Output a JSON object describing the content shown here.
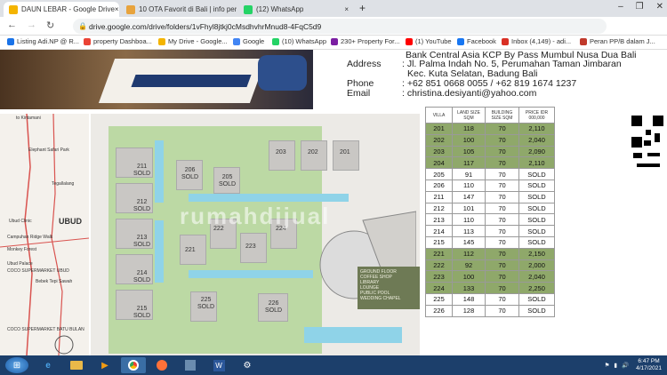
{
  "tabs": [
    {
      "title": "DAUN LEBAR - Google Drive",
      "color": "#f4b400",
      "active": true
    },
    {
      "title": "10 OTA Favorit di Bali | info perh",
      "color": "#e8a33d",
      "active": false
    },
    {
      "title": "(12) WhatsApp",
      "color": "#25d366",
      "active": false
    }
  ],
  "tab_close": "×",
  "new_tab": "+",
  "window_controls": [
    "–",
    "❐",
    "✕"
  ],
  "nav": {
    "back": "←",
    "forward": "→",
    "reload": "↻",
    "lock": "🔒"
  },
  "url": "drive.google.com/drive/folders/1vFhyl8jtkj0cMsdhvhrMnud8-4FqC5d9",
  "bookmarks": [
    {
      "label": "Listing Adi.NP @ R...",
      "color": "#1a73e8"
    },
    {
      "label": "property Dashboa...",
      "color": "#ea4335"
    },
    {
      "label": "My Drive - Google...",
      "color": "#f4b400"
    },
    {
      "label": "Google",
      "color": "#4285f4"
    },
    {
      "label": "(10) WhatsApp",
      "color": "#25d366"
    },
    {
      "label": "230+ Property For...",
      "color": "#7b1fa2"
    },
    {
      "label": "(1) YouTube",
      "color": "#ff0000"
    },
    {
      "label": "Facebook",
      "color": "#1877f2"
    },
    {
      "label": "Inbox (4,149) - adi...",
      "color": "#d93025"
    },
    {
      "label": "Peran PP/B dalam J...",
      "color": "#c0392b"
    }
  ],
  "contact": {
    "bank": "Bank Central Asia KCP By Pass Mumbul Nusa Dua Bali",
    "address_label": "Address",
    "address": [
      ": Jl. Palma Indah No. 5, Perumahan Taman Jimbaran",
      "Kec. Kuta Selatan, Badung Bali"
    ],
    "phone_label": "Phone",
    "phone": ": +62 851 0668 0055 / +62 819 1674 1237",
    "email_label": "Email",
    "email": ": christina.desiyanti@yahoo.com"
  },
  "map": {
    "title": "UBUD",
    "labels": [
      "to Kintamani",
      "Elephant Safari Park",
      "Ubud Clinic",
      "Campuhan Ridge Walk",
      "Monkey Forest",
      "Ubud Palace",
      "COCO SUPERMARKET UBUD",
      "Bebek Tepi Sawah",
      "COCO SUPERMARKET BATU BULAN",
      "Tegallalang"
    ]
  },
  "plan": {
    "villas": [
      {
        "num": "211",
        "status": "SOLD"
      },
      {
        "num": "212",
        "status": "SOLD"
      },
      {
        "num": "213",
        "status": "SOLD"
      },
      {
        "num": "214",
        "status": "SOLD"
      },
      {
        "num": "215",
        "status": "SOLD"
      },
      {
        "num": "206",
        "status": "SOLD"
      },
      {
        "num": "205",
        "status": "SOLD"
      },
      {
        "num": "221",
        "status": ""
      },
      {
        "num": "222",
        "status": ""
      },
      {
        "num": "223",
        "status": ""
      },
      {
        "num": "224",
        "status": ""
      },
      {
        "num": "225",
        "status": "SOLD"
      },
      {
        "num": "226",
        "status": "SOLD"
      },
      {
        "num": "203",
        "status": ""
      },
      {
        "num": "202",
        "status": ""
      },
      {
        "num": "201",
        "status": ""
      }
    ],
    "legend": [
      "GROUND FLOOR",
      "COFFEE SHOP",
      "LIBRARY",
      "LOUNGE",
      "PUBLIC POOL",
      "WEDDING CHAPEL"
    ]
  },
  "table": {
    "headers": [
      "VILLA",
      "LAND SIZE SQM",
      "BUILDING SIZE SQM",
      "PRICE IDR 000,000"
    ],
    "rows": [
      [
        "201",
        "118",
        "70",
        "2,110"
      ],
      [
        "202",
        "100",
        "70",
        "2,040"
      ],
      [
        "203",
        "105",
        "70",
        "2,090"
      ],
      [
        "204",
        "117",
        "70",
        "2,110"
      ],
      [
        "205",
        "91",
        "70",
        "SOLD"
      ],
      [
        "206",
        "110",
        "70",
        "SOLD"
      ],
      [
        "211",
        "147",
        "70",
        "SOLD"
      ],
      [
        "212",
        "101",
        "70",
        "SOLD"
      ],
      [
        "213",
        "110",
        "70",
        "SOLD"
      ],
      [
        "214",
        "113",
        "70",
        "SOLD"
      ],
      [
        "215",
        "145",
        "70",
        "SOLD"
      ],
      [
        "221",
        "112",
        "70",
        "2,150"
      ],
      [
        "222",
        "92",
        "70",
        "2,000"
      ],
      [
        "223",
        "100",
        "70",
        "2,040"
      ],
      [
        "224",
        "133",
        "70",
        "2,250"
      ],
      [
        "225",
        "148",
        "70",
        "SOLD"
      ],
      [
        "226",
        "128",
        "70",
        "SOLD"
      ]
    ]
  },
  "watermark": "rumahdijual",
  "taskbar": {
    "time": "6:47 PM",
    "date": "4/17/2021"
  }
}
